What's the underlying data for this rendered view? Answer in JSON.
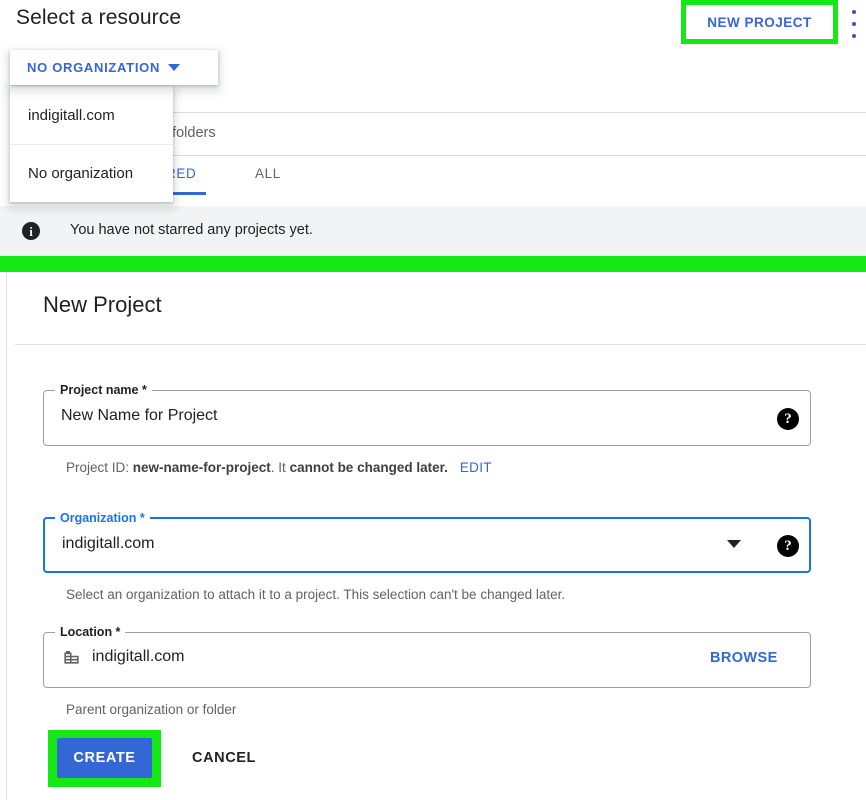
{
  "background": {
    "title": "Select a resource",
    "new_project_button": "NEW PROJECT",
    "kebab_menu_name": "more-options",
    "filter_row_text": "d folders",
    "tabs": [
      {
        "label": "RED",
        "active": true
      },
      {
        "label": "ALL",
        "active": false
      }
    ],
    "info_banner": {
      "icon": "info-icon",
      "text": "You have not starred any projects yet."
    },
    "org_dropdown": {
      "label": "NO ORGANIZATION",
      "caret": "chevron-down-icon",
      "options": [
        "indigitall.com",
        "No organization"
      ]
    }
  },
  "dialog": {
    "title": "New Project",
    "project_name": {
      "legend": "Project name *",
      "value": "New Name for Project",
      "help_icon": "help-icon"
    },
    "project_id": {
      "prefix": "Project ID: ",
      "id": "new-name-for-project",
      "middle": ". It ",
      "cannot": "cannot be changed later.",
      "edit_label": "EDIT"
    },
    "organization": {
      "legend": "Organization *",
      "value": "indigitall.com",
      "caret": "chevron-down-icon",
      "help_icon": "help-icon",
      "helper": "Select an organization to attach it to a project. This selection can't be changed later."
    },
    "location": {
      "legend": "Location *",
      "icon": "building-icon",
      "value": "indigitall.com",
      "browse_label": "BROWSE",
      "helper": "Parent organization or folder"
    },
    "actions": {
      "create_label": "CREATE",
      "cancel_label": "CANCEL"
    }
  },
  "colors": {
    "highlight_green": "#15e915",
    "primary_blue": "#3367d6",
    "focus_blue": "#1a73e8",
    "banner_gray": "#f1f3f4"
  }
}
